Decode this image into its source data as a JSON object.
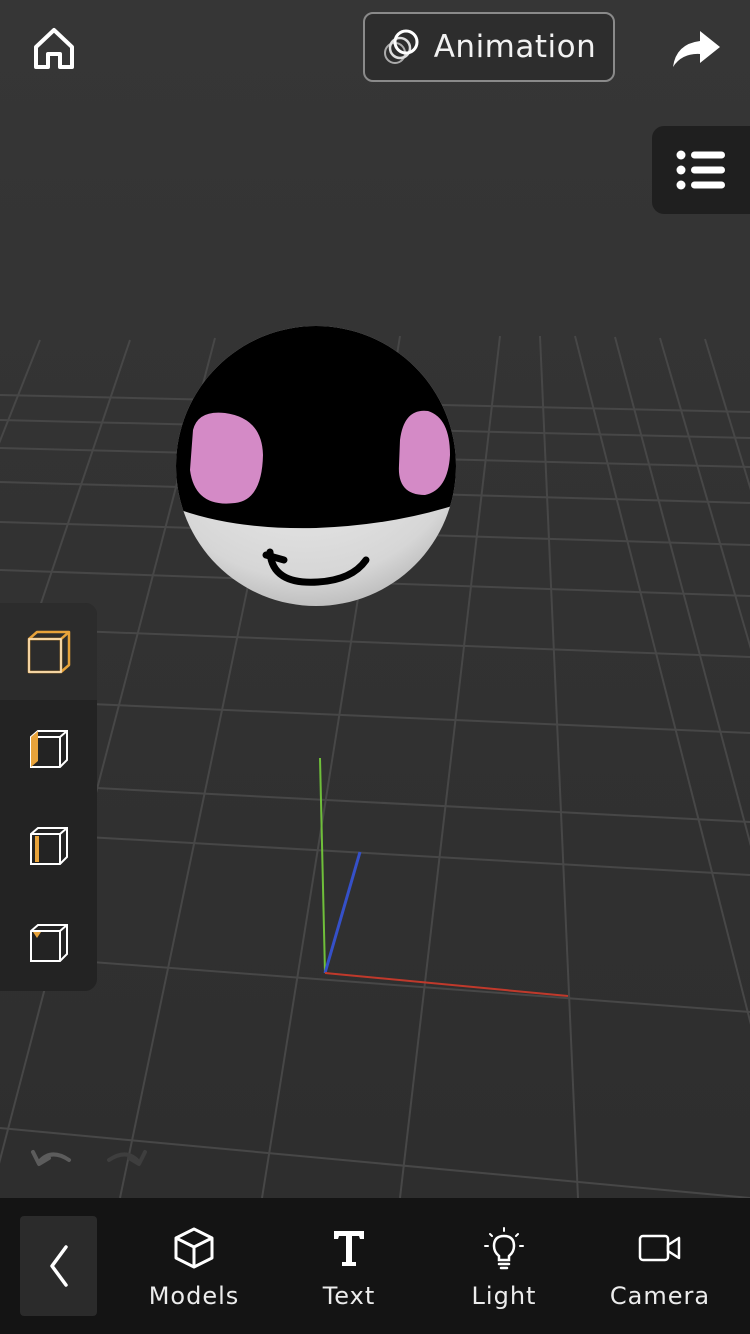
{
  "header": {
    "home_icon": "home-icon",
    "animation_label": "Animation",
    "animation_icon": "layers-icon",
    "share_icon": "share-arrow-icon"
  },
  "outline_icon": "list-icon",
  "view_panel": {
    "items": [
      {
        "name": "perspective-view",
        "icon": "cube-perspective-icon",
        "active": true
      },
      {
        "name": "side-view",
        "icon": "cube-side-icon",
        "active": false
      },
      {
        "name": "front-view",
        "icon": "cube-front-icon",
        "active": false
      },
      {
        "name": "top-view",
        "icon": "cube-top-icon",
        "active": false
      }
    ]
  },
  "history": {
    "undo_icon": "undo-icon",
    "redo_icon": "redo-icon",
    "redo_enabled": false
  },
  "toolbar": {
    "back_icon": "chevron-left-icon",
    "tools": [
      {
        "label": "Models",
        "icon": "cube-icon"
      },
      {
        "label": "Text",
        "icon": "text-t-icon"
      },
      {
        "label": "Light",
        "icon": "lightbulb-icon"
      },
      {
        "label": "Camera",
        "icon": "video-camera-icon"
      }
    ]
  },
  "colors": {
    "background": "#2f2f2f",
    "grid_line": "#474747",
    "accent_orange": "#e8a33a",
    "axis_x": "#c0392b",
    "axis_y": "#6fbf3a",
    "axis_z": "#3550c8",
    "model_top": "#000000",
    "model_bottom": "#d8d8d8",
    "model_eyes": "#d48ac6",
    "toolbar_bg": "#141414"
  }
}
